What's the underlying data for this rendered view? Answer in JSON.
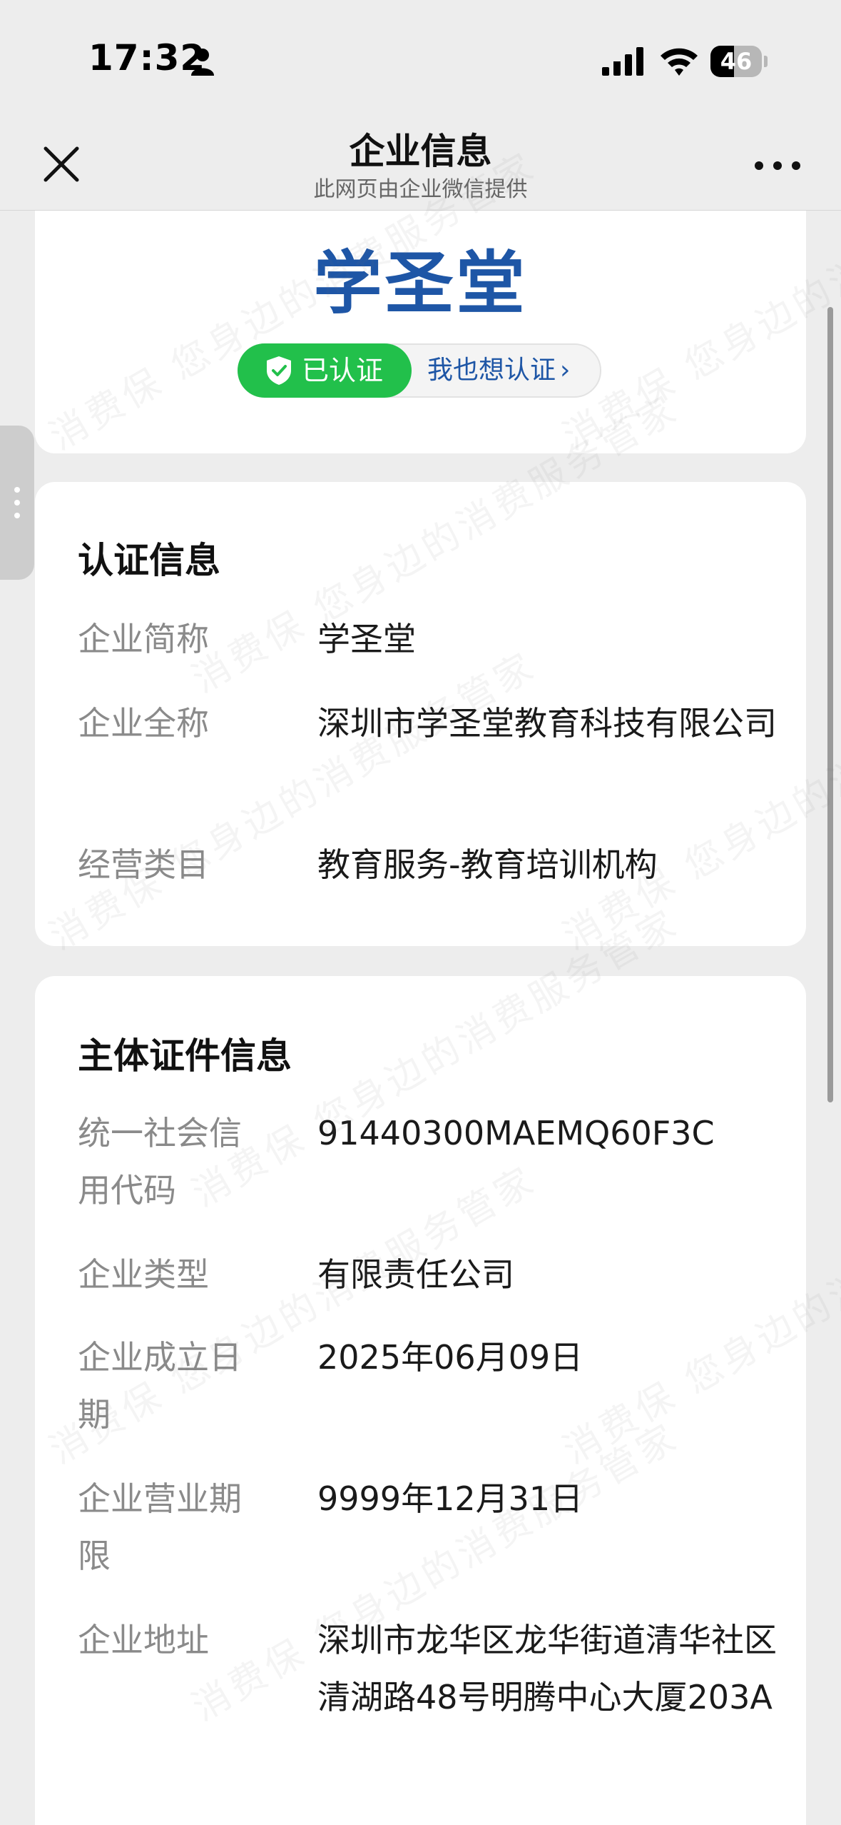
{
  "status_bar": {
    "time": "17:32",
    "battery": "46",
    "battery_level": 0.46
  },
  "nav": {
    "title": "企业信息",
    "subtitle": "此网页由企业微信提供"
  },
  "header_card": {
    "company_name": "学圣堂",
    "verified_label": "已认证",
    "want_verify_label": "我也想认证",
    "want_verify_chevron": "›"
  },
  "cert_info": {
    "title": "认证信息",
    "rows": [
      {
        "label": "企业简称",
        "value": "学圣堂"
      },
      {
        "label": "企业全称",
        "value": "深圳市学圣堂教育科技有限公司"
      },
      {
        "label": "经营类目",
        "value": "教育服务-教育培训机构"
      }
    ]
  },
  "subject_info": {
    "title": "主体证件信息",
    "rows": [
      {
        "label": "统一社会信用代码",
        "value": "91440300MAEMQ60F3C"
      },
      {
        "label": "企业类型",
        "value": "有限责任公司"
      },
      {
        "label": "企业成立日期",
        "value": "2025年06月09日"
      },
      {
        "label": "企业营业期限",
        "value": "9999年12月31日"
      },
      {
        "label": "企业地址",
        "value": "深圳市龙华区龙华街道清华社区清湖路48号明腾中心大厦203A"
      }
    ]
  },
  "watermark": {
    "text": "消费保 您身边的消费服务管家"
  },
  "colors": {
    "accent_blue": "#1e56a6",
    "verified_green": "#22c04b",
    "background": "#ededed"
  }
}
